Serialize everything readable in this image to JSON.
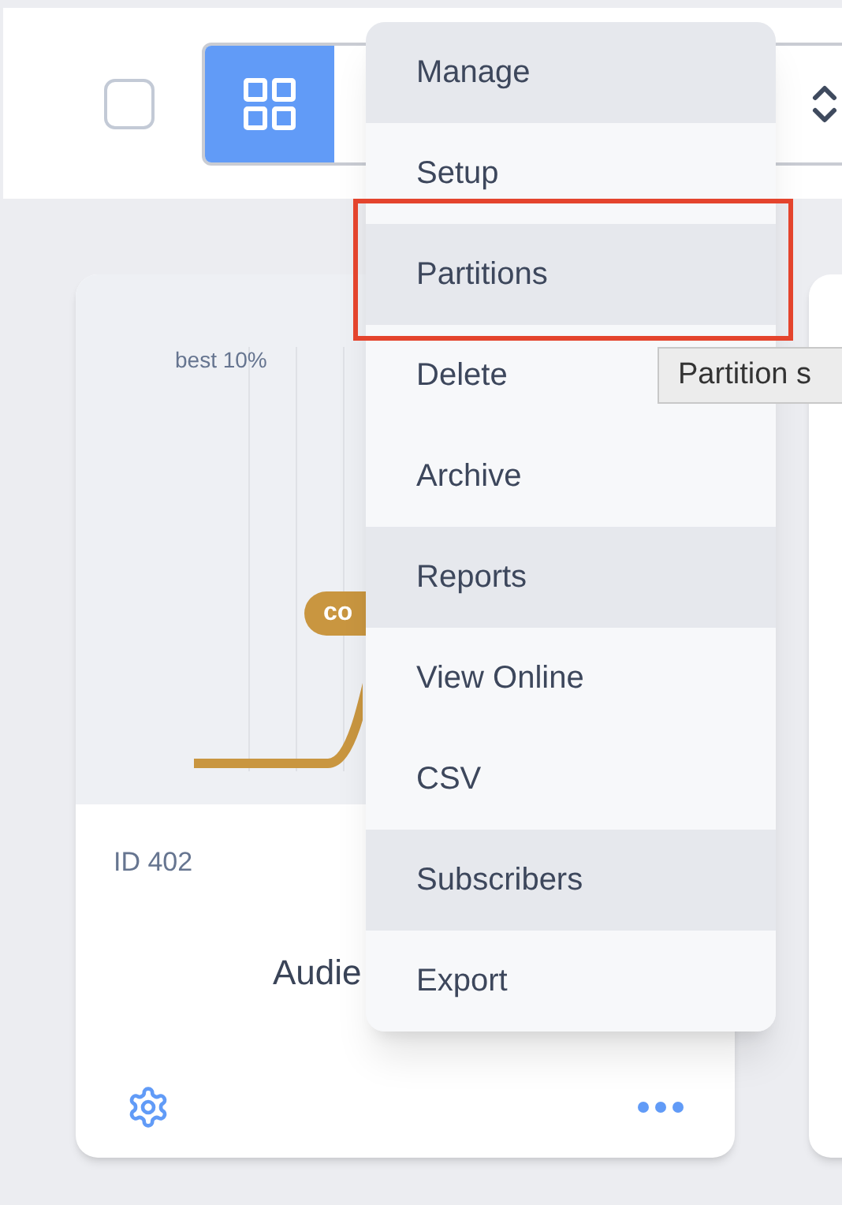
{
  "toolbar": {
    "select_all": {
      "checked": false
    },
    "view_toggle": {
      "selected": true
    }
  },
  "card": {
    "chart": {
      "threshold_label": "best 10%",
      "curve_label": "co"
    },
    "id": "ID 402",
    "title": "Audie"
  },
  "menu": {
    "items": [
      {
        "label": "Manage",
        "shaded": true,
        "highlighted": false
      },
      {
        "label": "Setup",
        "shaded": false,
        "highlighted": false
      },
      {
        "label": "Partitions",
        "shaded": true,
        "highlighted": true
      },
      {
        "label": "Delete",
        "shaded": false,
        "highlighted": false
      },
      {
        "label": "Archive",
        "shaded": false,
        "highlighted": false
      },
      {
        "label": "Reports",
        "shaded": true,
        "highlighted": false
      },
      {
        "label": "View Online",
        "shaded": false,
        "highlighted": false
      },
      {
        "label": "CSV",
        "shaded": false,
        "highlighted": false
      },
      {
        "label": "Subscribers",
        "shaded": true,
        "highlighted": false
      },
      {
        "label": "Export",
        "shaded": false,
        "highlighted": false
      }
    ]
  },
  "tooltip": "Partition s"
}
